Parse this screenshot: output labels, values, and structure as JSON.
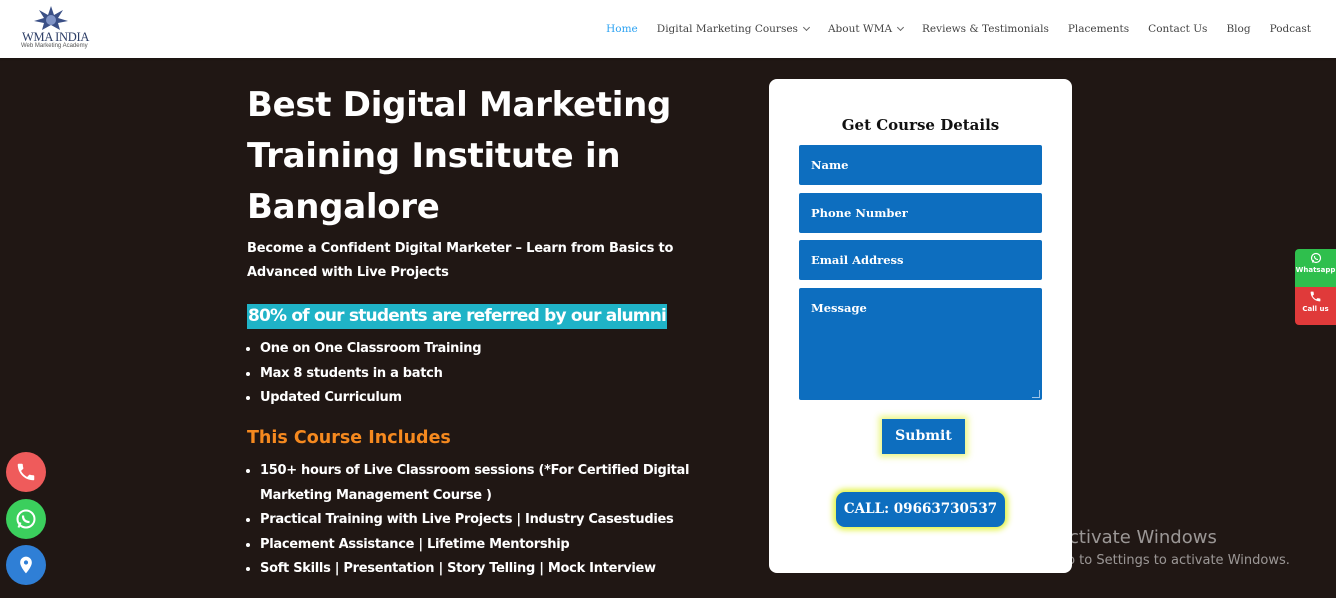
{
  "header": {
    "logo_title": "WMA INDIA",
    "logo_subtitle": "Web Marketing Academy",
    "nav": [
      {
        "label": "Home",
        "active": true
      },
      {
        "label": "Digital Marketing Courses",
        "dropdown": true
      },
      {
        "label": "About WMA",
        "dropdown": true
      },
      {
        "label": "Reviews & Testimonials"
      },
      {
        "label": "Placements"
      },
      {
        "label": "Contact Us"
      },
      {
        "label": "Blog"
      },
      {
        "label": "Podcast"
      }
    ]
  },
  "hero": {
    "title": "Best Digital Marketing Training Institute in Bangalore",
    "subtitle": "Become a Confident Digital Marketer – Learn from Basics to Advanced with Live Projects",
    "highlight": "80% of our students are referred by our alumni",
    "features": [
      "One on One Classroom Training",
      "Max 8 students in a batch",
      "Updated Curriculum"
    ],
    "includes_heading": "This Course Includes",
    "includes": [
      "150+ hours of Live Classroom sessions (*For Certified Digital Marketing Management Course )",
      "Practical Training with Live Projects | Industry Casestudies",
      "Placement Assistance | Lifetime Mentorship",
      "Soft Skills | Presentation | Story Telling | Mock Interview"
    ]
  },
  "form": {
    "title": "Get Course Details",
    "name_placeholder": "Name",
    "phone_placeholder": "Phone Number",
    "email_placeholder": "Email Address",
    "message_placeholder": "Message",
    "submit_label": "Submit",
    "call_label": "CALL: 09663730537"
  },
  "floating_right": {
    "whatsapp_label": "Whatsapp",
    "call_label": "Call us"
  },
  "floating_left": {
    "icons": [
      "phone-icon",
      "whatsapp-icon",
      "location-pin-icon"
    ]
  },
  "watermark": {
    "title": "Activate Windows",
    "subtitle": "Go to Settings to activate Windows."
  },
  "colors": {
    "background": "#201714",
    "accent_blue": "#0d6ebf",
    "nav_active": "#2ea3f2",
    "highlight_bg": "#1fb3c7",
    "includes_heading": "#f5891f",
    "whatsapp_green": "#2fbf4d",
    "call_red": "#e03a3a"
  }
}
